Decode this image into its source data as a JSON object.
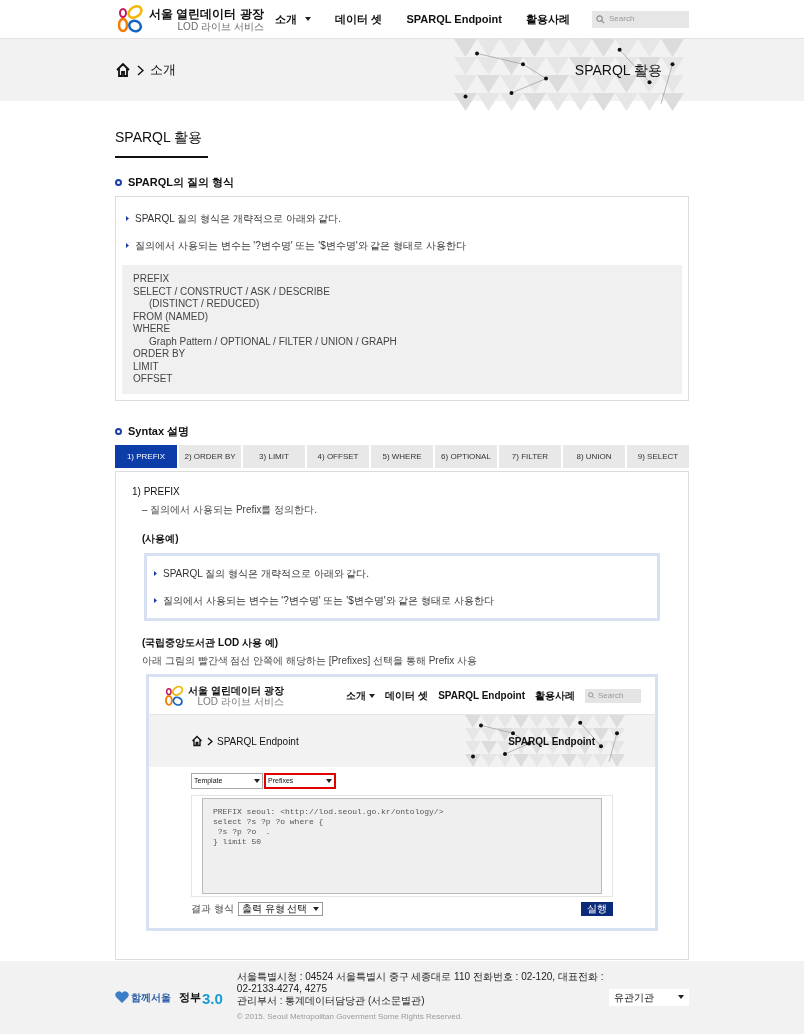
{
  "header": {
    "logo_title": "서울 열린데이터 광장",
    "logo_subtitle": "LOD 라이브 서비스",
    "nav": [
      {
        "label": "소개",
        "has_dropdown": true
      },
      {
        "label": "데이터 셋",
        "has_dropdown": false
      },
      {
        "label": "SPARQL Endpoint",
        "has_dropdown": false
      },
      {
        "label": "활용사례",
        "has_dropdown": false
      }
    ],
    "search": {
      "placeholder": "Search"
    }
  },
  "banner": {
    "breadcrumb": "소개",
    "title": "SPARQL 활용"
  },
  "page_title": "SPARQL 활용",
  "query_form": {
    "heading": "SPARQL의 질의 형식",
    "bullets": [
      "SPARQL 질의 형식은 개략적으로 아래와 같다.",
      "질의에서 사용되는 변수는 '?변수명' 또는 '$변수명'와 같은 형태로 사용한다"
    ],
    "code": [
      {
        "text": "PREFIX"
      },
      {
        "text": "SELECT / CONSTRUCT / ASK / DESCRIBE",
        "children": [
          {
            "text": "(DISTINCT / REDUCED)"
          }
        ]
      },
      {
        "text": "FROM (NAMED)"
      },
      {
        "text": "WHERE",
        "children": [
          {
            "text": "Graph Pattern / OPTIONAL / FILTER / UNION / GRAPH"
          }
        ]
      },
      {
        "text": "ORDER BY"
      },
      {
        "text": "LIMIT"
      },
      {
        "text": "OFFSET"
      }
    ]
  },
  "syntax": {
    "heading": "Syntax 설명",
    "tabs": [
      {
        "label": "1) PREFIX",
        "selected": true
      },
      {
        "label": "2) ORDER BY",
        "selected": false
      },
      {
        "label": "3) LIMIT",
        "selected": false
      },
      {
        "label": "4) OFFSET",
        "selected": false
      },
      {
        "label": "5) WHERE",
        "selected": false
      },
      {
        "label": "6) OPTIONAL",
        "selected": false
      },
      {
        "label": "7) FILTER",
        "selected": false
      },
      {
        "label": "8) UNION",
        "selected": false
      },
      {
        "label": "9) SELECT",
        "selected": false
      }
    ],
    "panel": {
      "title": "1) PREFIX",
      "description": "– 질의에서 사용되는 Prefix를 정의한다.",
      "example_label": "(사용예)",
      "example_bullets": [
        "SPARQL 질의 형식은 개략적으로 아래와 같다.",
        "질의에서 사용되는 변수는 '?변수명' 또는 '$변수명'와 같은 형태로 사용한다"
      ],
      "case_title": "(국립중앙도서관 LOD 사용 예)",
      "case_caption": "아래 그림의 빨간색 점선 안쪽에 해당하는 [Prefixes] 선택을 통해 Prefix 사용",
      "screenshot": {
        "logo_title": "서울 열린데이터 광장",
        "logo_subtitle": "LOD 라이브 서비스",
        "nav": [
          {
            "label": "소개",
            "has_dropdown": true
          },
          {
            "label": "데이터 셋",
            "has_dropdown": false
          },
          {
            "label": "SPARQL Endpoint",
            "has_dropdown": false
          },
          {
            "label": "활용사례",
            "has_dropdown": false
          }
        ],
        "search_placeholder": "Search",
        "breadcrumb": "SPARQL Endpoint",
        "banner_title": "SPARQL Endpoint",
        "selects": [
          {
            "value": "Template",
            "highlighted": false
          },
          {
            "value": "Prefixes",
            "highlighted": true
          }
        ],
        "query": [
          "PREFIX seoul: <http://lod.seoul.go.kr/ontology/>",
          "select ?s ?p ?o where {",
          " ?s ?p ?o  .",
          "} limit 50"
        ],
        "result_label": "결과 형식",
        "result_select": "출력 유형 선택",
        "run_button": "실행"
      }
    }
  },
  "footer": {
    "logo_text": "함께서울",
    "gov_text": "정부",
    "gov_version": "3.0",
    "address": "서울특별시청 : 04524 서울특별시 중구 세종대로 110 전화번호 : 02-120, 대표전화 : 02-2133-4274, 4275",
    "department": "관리부서 : 통계데이터담당관 (서소문별관)",
    "copyright": "© 2015. Seoul Metropolitan Goverment Some Rights Reserved.",
    "related_select": "유관기관"
  }
}
